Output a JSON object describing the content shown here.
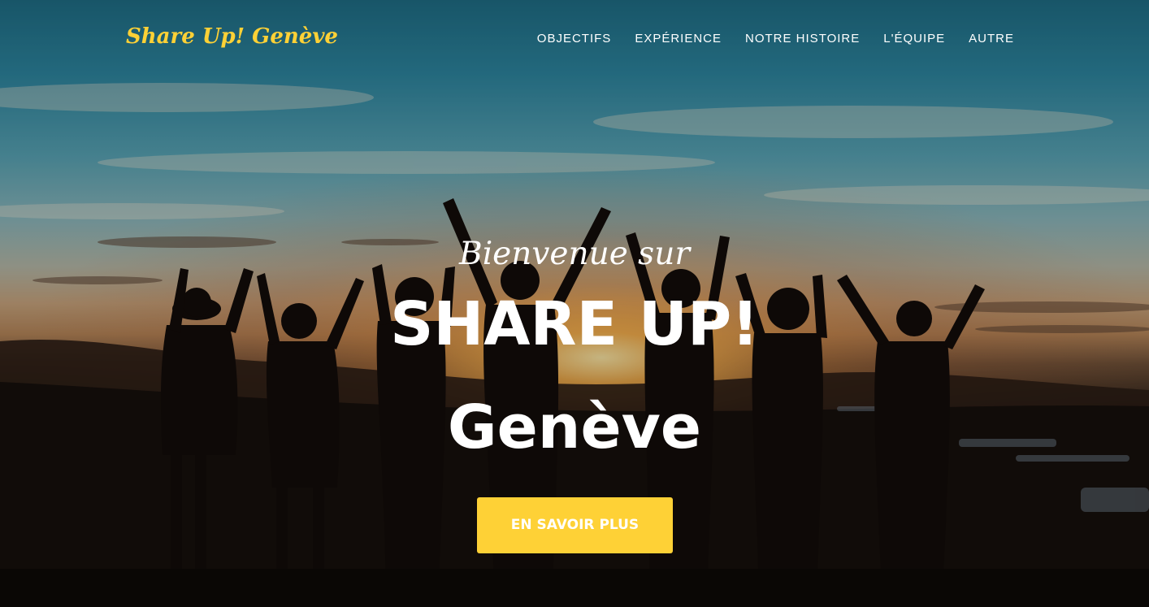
{
  "brand": {
    "name": "Share Up! Genève",
    "color": "#fed136"
  },
  "nav": {
    "items": [
      {
        "label": "OBJECTIFS"
      },
      {
        "label": "EXPÉRIENCE"
      },
      {
        "label": "NOTRE HISTOIRE"
      },
      {
        "label": "L'ÉQUIPE"
      },
      {
        "label": "AUTRE"
      }
    ]
  },
  "intro": {
    "lead_in": "Bienvenue sur",
    "heading_line1": "SHARE UP!",
    "heading_line2": "Genève",
    "cta_label": "EN SAVOIR PLUS"
  },
  "colors": {
    "accent": "#fed136",
    "text": "#ffffff"
  }
}
